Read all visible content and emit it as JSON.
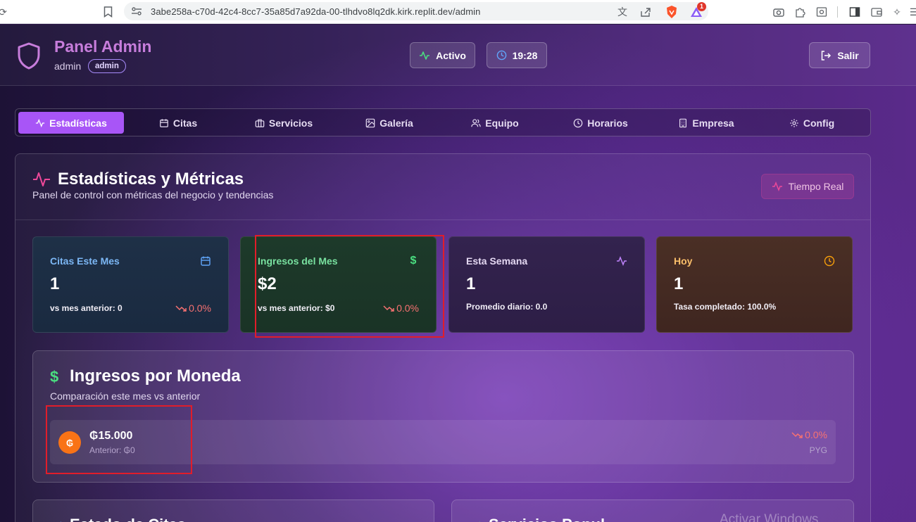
{
  "browser": {
    "url": "3abe258a-c70d-42c4-8cc7-35a85d7a92da-00-tlhdvo8lq2dk.kirk.replit.dev/admin",
    "brave_badge": "1"
  },
  "header": {
    "title": "Panel Admin",
    "username": "admin",
    "role": "admin",
    "status_label": "Activo",
    "clock": "19:28",
    "logout_label": "Salir"
  },
  "tabs": [
    {
      "label": "Estadísticas",
      "icon": "activity-icon",
      "active": true
    },
    {
      "label": "Citas",
      "icon": "calendar-icon"
    },
    {
      "label": "Servicios",
      "icon": "briefcase-icon"
    },
    {
      "label": "Galería",
      "icon": "image-icon"
    },
    {
      "label": "Equipo",
      "icon": "users-icon"
    },
    {
      "label": "Horarios",
      "icon": "clock-icon"
    },
    {
      "label": "Empresa",
      "icon": "building-icon"
    },
    {
      "label": "Config",
      "icon": "gear-icon"
    }
  ],
  "stats": {
    "title": "Estadísticas y Métricas",
    "subtitle": "Panel de control con métricas del negocio y tendencias",
    "realtime_label": "Tiempo Real",
    "cards": [
      {
        "label": "Citas Este Mes",
        "value": "1",
        "foot": "vs mes anterior: 0",
        "trend": "0.0%",
        "icon": "calendar-icon",
        "accent": "#7cb7f5"
      },
      {
        "label": "Ingresos del Mes",
        "value": "$2",
        "foot": "vs mes anterior: $0",
        "trend": "0.0%",
        "icon": "dollar-icon",
        "accent": "#79e2a0"
      },
      {
        "label": "Esta Semana",
        "value": "1",
        "foot": "Promedio diario: 0.0",
        "icon": "activity-icon",
        "accent": "#c084fc"
      },
      {
        "label": "Hoy",
        "value": "1",
        "foot": "Tasa completado: 100.0%",
        "icon": "clock-icon",
        "accent": "#fbbf6a"
      }
    ]
  },
  "currency": {
    "title": "Ingresos por Moneda",
    "subtitle": "Comparación este mes vs anterior",
    "rows": [
      {
        "symbol": "₲",
        "amount": "₲15.000",
        "previous": "Anterior: ₲0",
        "trend": "0.0%",
        "code": "PYG"
      }
    ]
  },
  "bottom": {
    "card1_title": "Estado de Citas",
    "card2_title": "Servicios Popul..."
  },
  "watermark": "Activar Windows",
  "colors": {
    "accent": "#a855f7",
    "pink": "#ec4899",
    "trend_down": "#f87171",
    "highlight": "#e11d2a"
  }
}
